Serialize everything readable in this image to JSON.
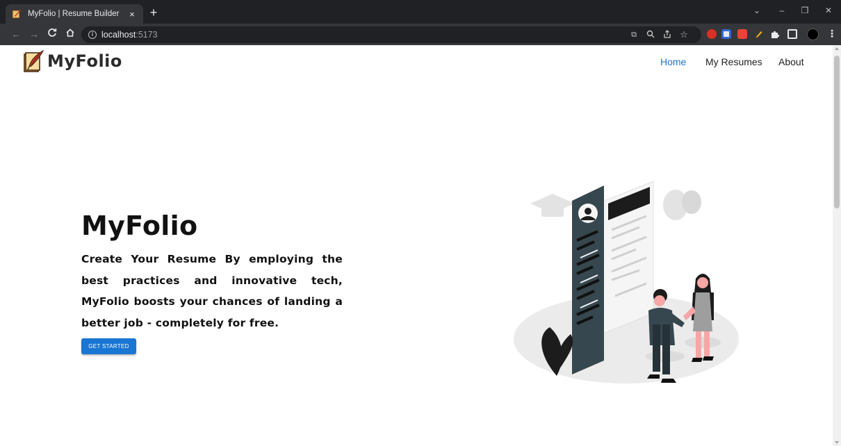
{
  "browser": {
    "tab_title": "MyFolio | Resume Builder",
    "tab_close": "×",
    "new_tab": "+",
    "url_host": "localhost",
    "url_port": ":5173",
    "window_controls": {
      "dropdown": "⌄",
      "minimize": "–",
      "restore": "❐",
      "close": "✕"
    }
  },
  "site": {
    "logo_text": "MyFolio",
    "nav": [
      {
        "label": "Home",
        "active": true
      },
      {
        "label": "My Resumes",
        "active": false
      },
      {
        "label": "About",
        "active": false
      }
    ]
  },
  "hero": {
    "title": "MyFolio",
    "description": "Create Your Resume By employing the best practices and innovative tech, MyFolio boosts your chances of landing a better job - completely for free.",
    "cta_label": "GET STARTED"
  },
  "colors": {
    "accent": "#1976d2",
    "chrome_dark": "#202124",
    "chrome_tab": "#35363a",
    "illustration_dark": "#37474f"
  }
}
